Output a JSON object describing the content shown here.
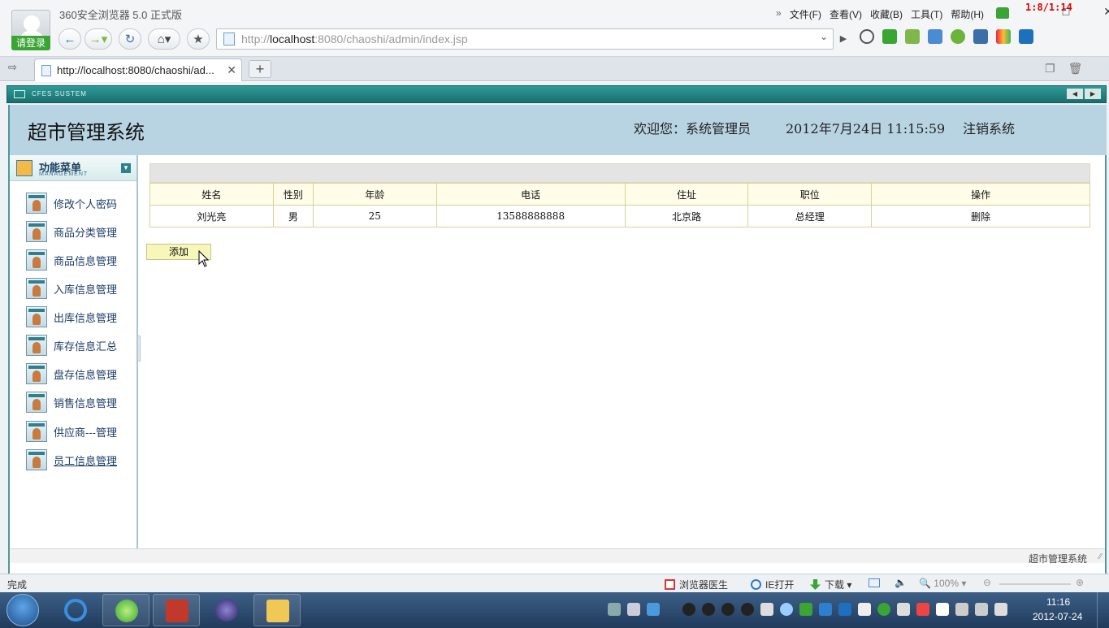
{
  "browser": {
    "app_title": "360安全浏览器 5.0 正式版",
    "login_label": "请登录",
    "menu_chevron": "»",
    "menu": [
      "文件(F)",
      "查看(V)",
      "收藏(B)",
      "工具(T)",
      "帮助(H)"
    ],
    "clock_overlay": "1:8/1:14",
    "window_controls": [
      "–",
      "□",
      "✕"
    ],
    "nav_icons": [
      "back-icon",
      "forward-icon",
      "refresh-icon",
      "home-icon",
      "star-icon"
    ],
    "address": {
      "scheme": "http://",
      "host": "localhost",
      "rest": ":8080/chaoshi/admin/index.jsp"
    },
    "tab": {
      "title": "http://localhost:8080/chaoshi/ad...",
      "close": "✕",
      "new_tab": "+"
    }
  },
  "page": {
    "banner_label": "CFES SUSTEM",
    "system_title": "超市管理系统",
    "welcome": "欢迎您：系统管理员",
    "datetime": "2012年7月24日  11:15:59",
    "logout": "注销系统",
    "menu_head": {
      "title": "功能菜单",
      "subtitle": "MANAGEMENT"
    },
    "menu_items": [
      "修改个人密码",
      "商品分类管理",
      "商品信息管理",
      "入库信息管理",
      "出库信息管理",
      "库存信息汇总",
      "盘存信息管理",
      "销售信息管理",
      "供应商---管理",
      "员工信息管理"
    ],
    "table": {
      "headers": [
        "姓名",
        "性别",
        "年龄",
        "电话",
        "住址",
        "职位",
        "操作"
      ],
      "rows": [
        [
          "刘光亮",
          "男",
          "25",
          "13588888888",
          "北京路",
          "总经理",
          "删除"
        ]
      ]
    },
    "add_button": "添加",
    "footer": "超市管理系统"
  },
  "statusbar": {
    "status": "完成",
    "doctor": "浏览器医生",
    "ie_open": "IE打开",
    "download": "下载",
    "zoom": "100%"
  },
  "taskbar": {
    "time": "11:16",
    "date": "2012-07-24"
  },
  "colors": {
    "header_bg": "#b8d4e3",
    "banner": "#1f7a78",
    "table_border": "#d6d29a",
    "add_button": "#f7f7b9",
    "login_green": "#3aa535"
  }
}
